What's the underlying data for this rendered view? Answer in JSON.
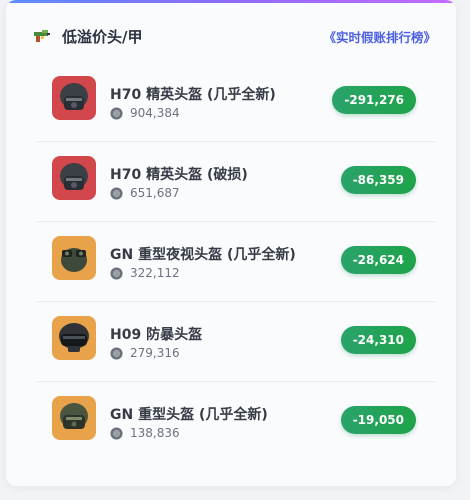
{
  "header": {
    "title": "低溢价头/甲",
    "link": "《实时假账排行榜》",
    "icon": "gun-icon"
  },
  "colors": {
    "accent_link": "#4d61e0",
    "badge_green": "#1fa34a",
    "thumb_red": "#d2474c",
    "thumb_orange": "#e8a34a"
  },
  "items": [
    {
      "name": "H70 精英头盔 (几乎全新)",
      "price": "904,384",
      "delta": "-291,276",
      "thumb": "red",
      "icon": "elite-helmet-icon"
    },
    {
      "name": "H70 精英头盔 (破损)",
      "price": "651,687",
      "delta": "-86,359",
      "thumb": "red",
      "icon": "elite-helmet-icon"
    },
    {
      "name": "GN 重型夜视头盔 (几乎全新)",
      "price": "322,112",
      "delta": "-28,624",
      "thumb": "orange",
      "icon": "night-vision-helmet-icon"
    },
    {
      "name": "H09 防暴头盔",
      "price": "279,316",
      "delta": "-24,310",
      "thumb": "orange",
      "icon": "riot-helmet-icon"
    },
    {
      "name": "GN 重型头盔 (几乎全新)",
      "price": "138,836",
      "delta": "-19,050",
      "thumb": "orange",
      "icon": "heavy-helmet-icon"
    }
  ]
}
